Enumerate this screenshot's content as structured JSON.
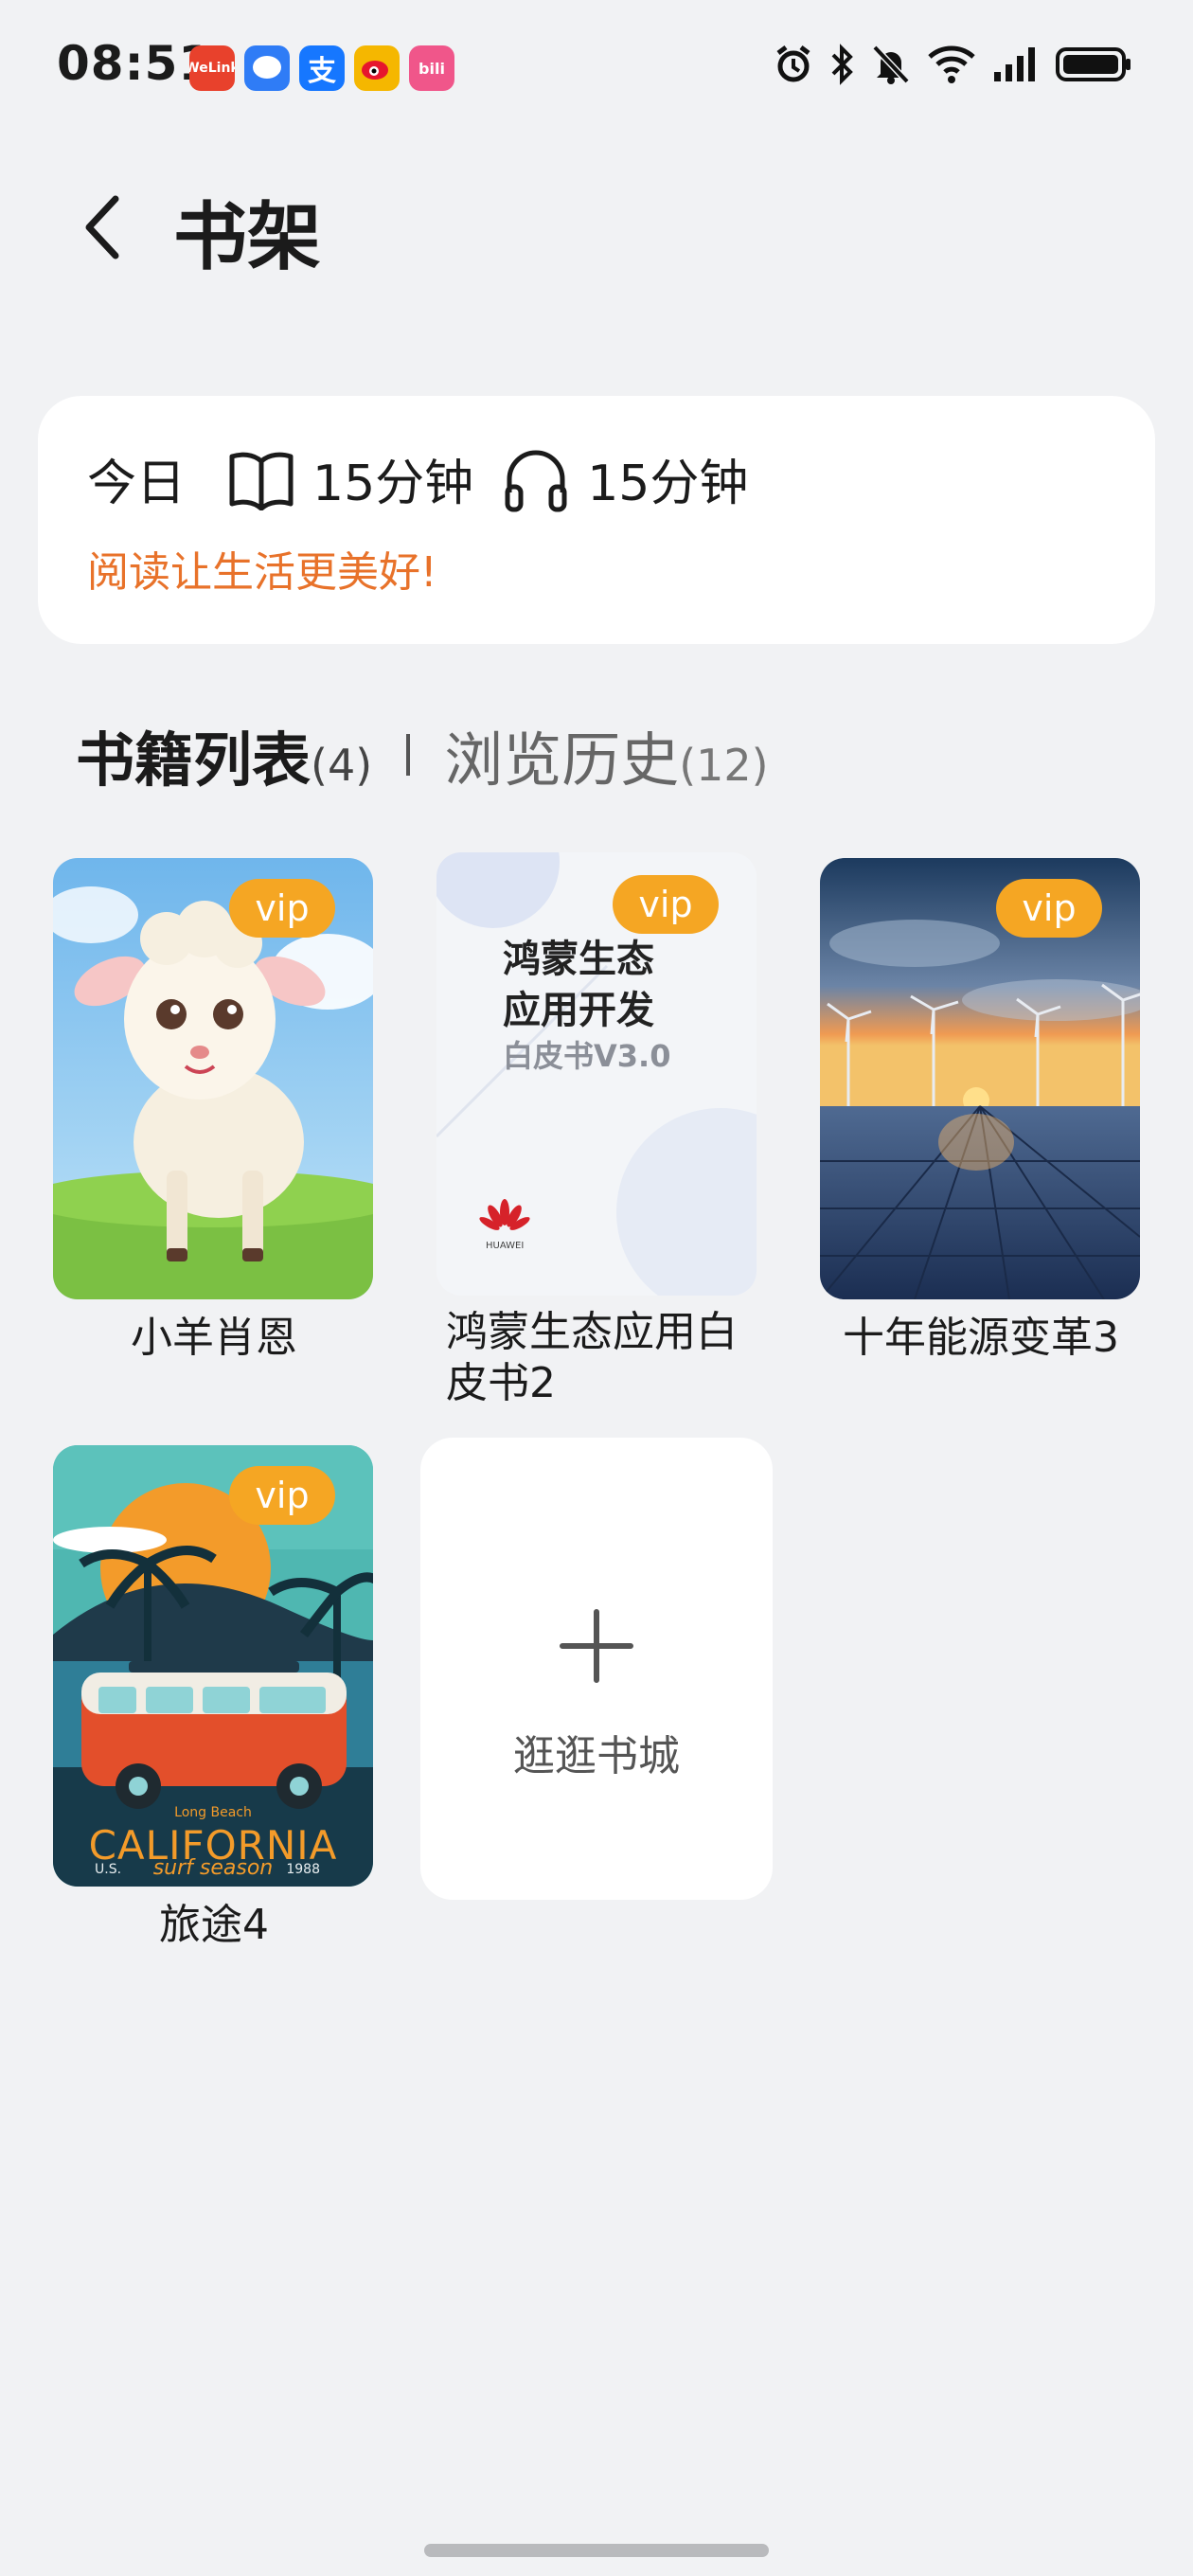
{
  "status_bar": {
    "time": "08:51",
    "apps": [
      {
        "name": "welink-icon",
        "label": "WeLink",
        "color": "#e8412c"
      },
      {
        "name": "messages-icon",
        "label": "",
        "color": "#2f7cf6"
      },
      {
        "name": "alipay-icon",
        "label": "支",
        "color": "#1677ff"
      },
      {
        "name": "weibo-icon",
        "label": "",
        "color": "#f5b700"
      },
      {
        "name": "bilibili-icon",
        "label": "bili",
        "color": "#f0568a"
      }
    ]
  },
  "header": {
    "title": "书架"
  },
  "stats": {
    "today_label": "今日",
    "reading_time": "15分钟",
    "listening_time": "15分钟",
    "slogan": "阅读让生活更美好!"
  },
  "tabs": {
    "books_label": "书籍列表",
    "books_count": "(4)",
    "history_label": "浏览历史",
    "history_count": "(12)"
  },
  "books": [
    {
      "title": "小羊肖恩",
      "badge": "vip"
    },
    {
      "title": "鸿蒙生态应用白皮书2",
      "badge": "vip",
      "cover_title_1": "鸿蒙生态",
      "cover_title_2": "应用开发",
      "cover_subtitle": "白皮书V3.0",
      "cover_brand": "HUAWEI"
    },
    {
      "title": "十年能源变革3",
      "badge": "vip"
    },
    {
      "title": "旅途4",
      "badge": "vip",
      "cover_small": "Long Beach",
      "cover_main": "CALIFORNIA",
      "cover_left": "U.S.",
      "cover_mid": "surf season",
      "cover_right": "1988"
    }
  ],
  "add_card": {
    "label": "逛逛书城"
  },
  "colors": {
    "accent": "#f5a623",
    "slogan": "#e8722a",
    "background": "#f1f2f4"
  }
}
